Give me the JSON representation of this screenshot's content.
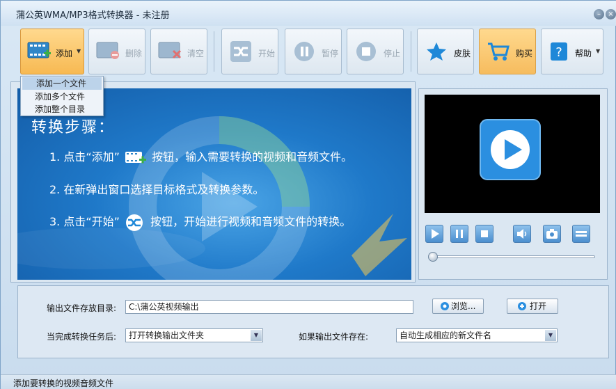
{
  "window": {
    "title": "蒲公英WMA/MP3格式转换器 - 未注册",
    "close_glyph": "×"
  },
  "toolbar": {
    "add_label": "添加",
    "delete_label": "删除",
    "clear_label": "清空",
    "start_label": "开始",
    "pause_label": "暂停",
    "stop_label": "停止",
    "skin_label": "皮肤",
    "buy_label": "购买",
    "help_label": "帮助"
  },
  "add_menu": {
    "items": [
      "添加一个文件",
      "添加多个文件",
      "添加整个目录"
    ]
  },
  "banner": {
    "heading": "转换步骤：",
    "step1_a": "1. 点击“添加”",
    "step1_b": "按钮，输入需要转换的视频和音频文件。",
    "step2": "2. 在新弹出窗口选择目标格式及转换参数。",
    "step3_a": "3. 点击“开始”",
    "step3_b": "按钮，开始进行视频和音频文件的转换。"
  },
  "settings": {
    "output_dir_label": "输出文件存放目录:",
    "output_dir_value": "C:\\蒲公英视频输出",
    "browse_label": "浏览...",
    "open_label": "打开",
    "on_complete_label": "当完成转换任务后:",
    "on_complete_value": "打开转换输出文件夹",
    "if_exists_label": "如果输出文件存在:",
    "if_exists_value": "自动生成相应的新文件名"
  },
  "status": {
    "text": "添加要转换的视频音频文件"
  },
  "colors": {
    "accent_orange": "#f7b952",
    "banner_blue": "#1f79c9",
    "window_bg": "#cfe0ef"
  }
}
